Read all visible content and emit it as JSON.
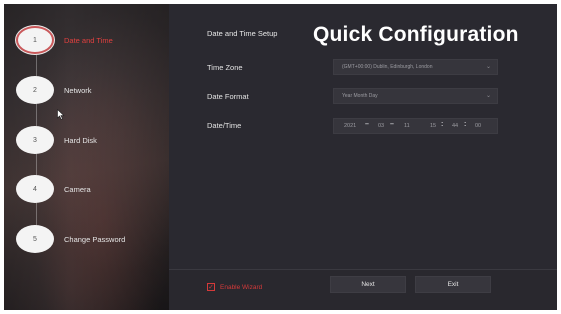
{
  "sidebar": {
    "steps": [
      {
        "number": "1",
        "label": "Date and Time",
        "active": true
      },
      {
        "number": "2",
        "label": "Network",
        "active": false
      },
      {
        "number": "3",
        "label": "Hard Disk",
        "active": false
      },
      {
        "number": "4",
        "label": "Camera",
        "active": false
      },
      {
        "number": "5",
        "label": "Change Password",
        "active": false
      }
    ]
  },
  "main": {
    "section_title": "Date and Time Setup",
    "page_title": "Quick Configuration",
    "time_zone": {
      "label": "Time Zone",
      "value": "(GMT+00:00) Dublin, Edinburgh, London"
    },
    "date_format": {
      "label": "Date Format",
      "value": "Year Month Day"
    },
    "date_time": {
      "label": "Date/Time",
      "year": "2021",
      "month": "03",
      "day": "11",
      "hour": "15",
      "minute": "44",
      "second": "00",
      "date_separator": "–",
      "time_separator": ":"
    }
  },
  "footer": {
    "enable_wizard_label": "Enable Wizard",
    "enable_wizard_checked": true,
    "next_label": "Next",
    "exit_label": "Exit"
  },
  "colors": {
    "accent": "#d43a3a",
    "background": "#2a2930",
    "field": "#36353c"
  },
  "icons": {
    "dropdown": "chevron-down-icon",
    "checkbox": "checkmark-icon",
    "cursor": "mouse-pointer-icon"
  }
}
